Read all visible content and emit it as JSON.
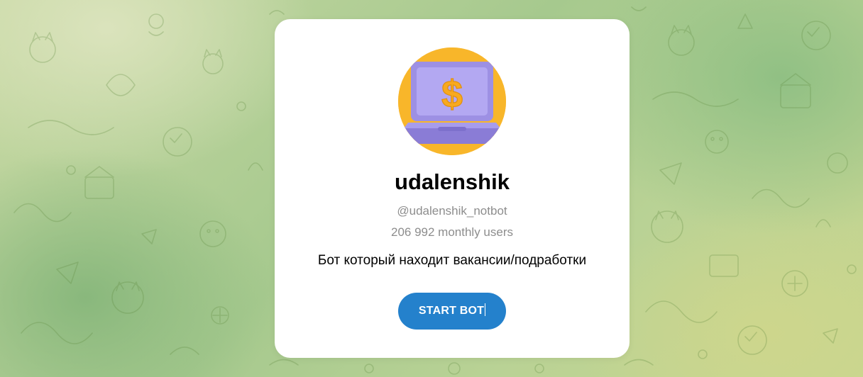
{
  "bot": {
    "name": "udalenshik",
    "handle": "@udalenshik_notbot",
    "monthly_users": "206 992 monthly users",
    "description": "Бот который находит вакансии/подработки",
    "avatar_icon": "laptop-dollar-icon"
  },
  "actions": {
    "start_label": "START BOT"
  },
  "colors": {
    "accent": "#2481cc",
    "avatar_bg": "#f8b62a",
    "laptop": "#9b8fe0",
    "dollar": "#f8a91f",
    "secondary_text": "#8d8d8d"
  },
  "background": {
    "pattern_icon": "doodle-pattern"
  }
}
